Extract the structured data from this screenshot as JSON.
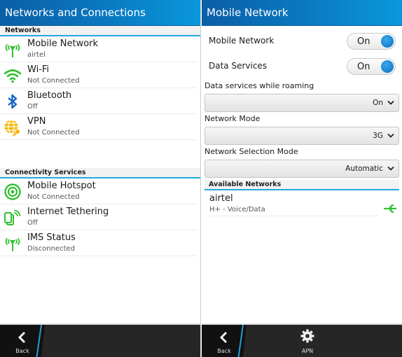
{
  "left": {
    "title": "Networks and Connections",
    "sections": [
      {
        "header": "Networks",
        "items": [
          {
            "title": "Mobile Network",
            "subtitle": "airtel",
            "icon": "cell-tower-icon"
          },
          {
            "title": "Wi-Fi",
            "subtitle": "Not Connected",
            "icon": "wifi-icon"
          },
          {
            "title": "Bluetooth",
            "subtitle": "Off",
            "icon": "bluetooth-icon"
          },
          {
            "title": "VPN",
            "subtitle": "Not Connected",
            "icon": "vpn-globe-key-icon"
          }
        ]
      },
      {
        "header": "Connectivity Services",
        "items": [
          {
            "title": "Mobile Hotspot",
            "subtitle": "Not Connected",
            "icon": "hotspot-icon"
          },
          {
            "title": "Internet Tethering",
            "subtitle": "Off",
            "icon": "tethering-icon"
          },
          {
            "title": "IMS Status",
            "subtitle": "Disconnected",
            "icon": "cell-tower-icon"
          }
        ]
      }
    ],
    "actionbar": {
      "back_label": "Back"
    }
  },
  "right": {
    "title": "Mobile Network",
    "toggles": [
      {
        "label": "Mobile Network",
        "value": "On"
      },
      {
        "label": "Data Services",
        "value": "On"
      }
    ],
    "fields": [
      {
        "label": "Data services while roaming",
        "value": "On"
      },
      {
        "label": "Network Mode",
        "value": "3G"
      },
      {
        "label": "Network Selection Mode",
        "value": "Automatic"
      }
    ],
    "available_header": "Available Networks",
    "networks": [
      {
        "name": "airtel",
        "detail": "H+ - Voice/Data",
        "status_icon": "connected-plug-icon"
      }
    ],
    "actionbar": {
      "back_label": "Back",
      "apn_label": "APN"
    }
  },
  "colors": {
    "accent_blue": "#23a9e1",
    "title_gradient_start": "#0b5fa6",
    "title_gradient_end": "#0a98dc",
    "icon_green": "#2fc12f",
    "bluetooth_blue": "#1565c0",
    "vpn_yellow": "#f2b705",
    "actionbar_bg": "#262626"
  }
}
